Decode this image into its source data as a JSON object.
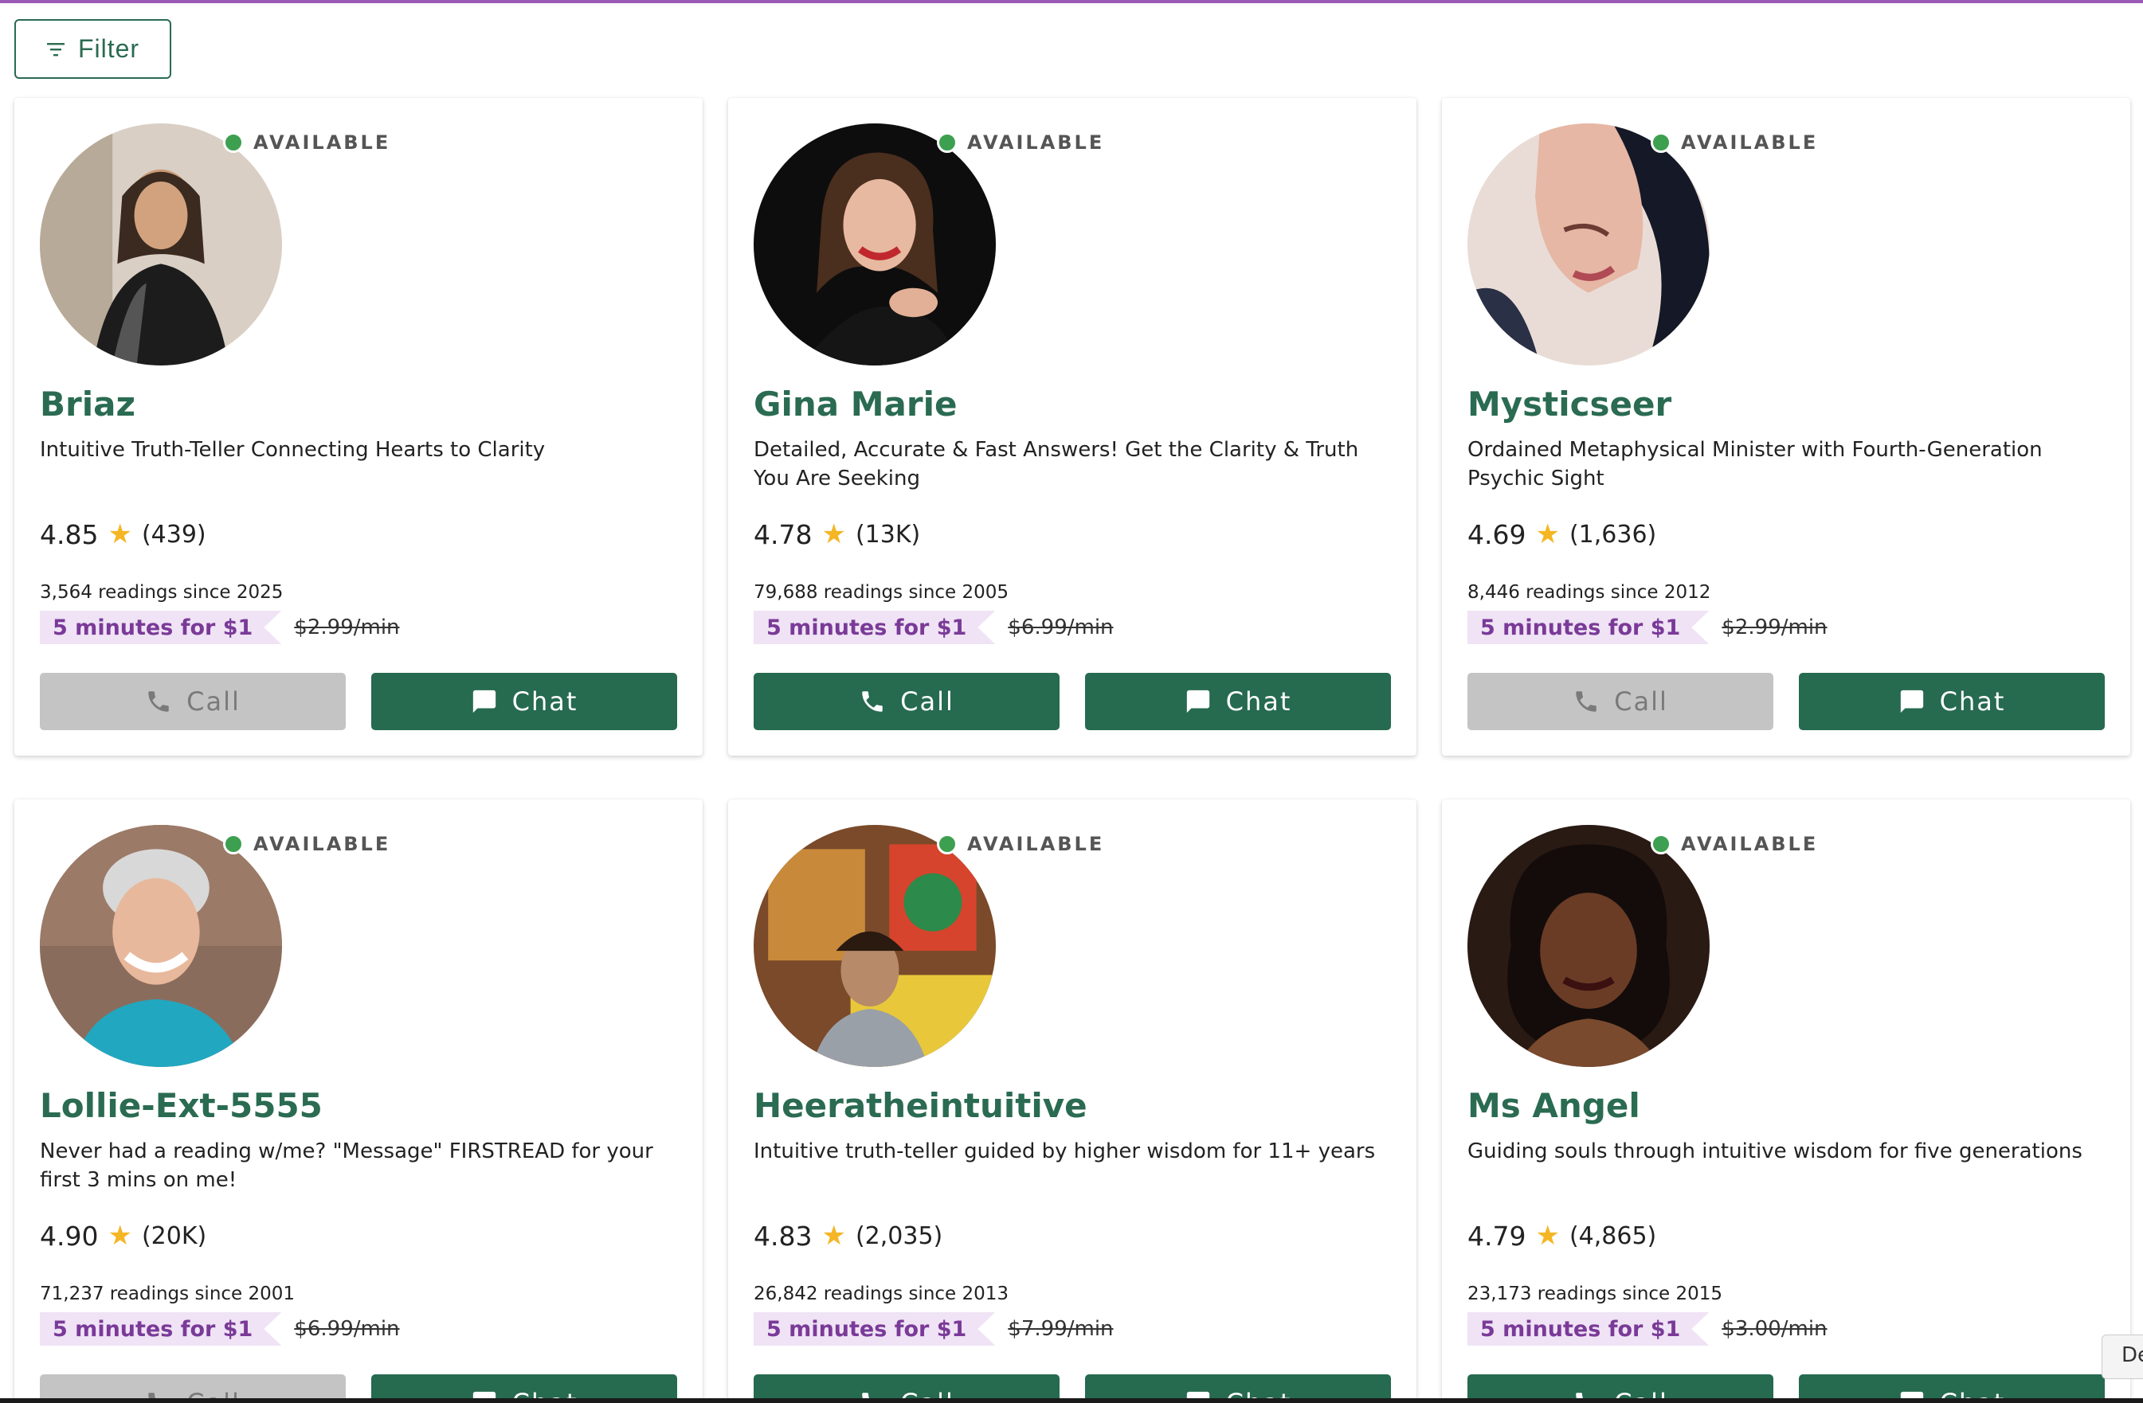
{
  "toolbar": {
    "filter_label": "Filter"
  },
  "colors": {
    "accent": "#266a50",
    "promo_bg": "#efe3f5",
    "promo_text": "#7a3a98",
    "available": "#3da050",
    "star": "#f5b625"
  },
  "advisors": [
    {
      "status": "AVAILABLE",
      "name": "Briaz",
      "tagline": "Intuitive Truth-Teller Connecting Hearts to Clarity",
      "rating": "4.85",
      "reviews": "(439)",
      "readings": "3,564 readings since 2025",
      "promo": "5 minutes for $1",
      "price": "$2.99/min",
      "call_label": "Call",
      "chat_label": "Chat",
      "call_enabled": false
    },
    {
      "status": "AVAILABLE",
      "name": "Gina Marie",
      "tagline": "Detailed, Accurate & Fast Answers! Get the Clarity & Truth You Are Seeking",
      "rating": "4.78",
      "reviews": "(13K)",
      "readings": "79,688 readings since 2005",
      "promo": "5 minutes for $1",
      "price": "$6.99/min",
      "call_label": "Call",
      "chat_label": "Chat",
      "call_enabled": true
    },
    {
      "status": "AVAILABLE",
      "name": "Mysticseer",
      "tagline": "Ordained Metaphysical Minister with Fourth-Generation Psychic Sight",
      "rating": "4.69",
      "reviews": "(1,636)",
      "readings": "8,446 readings since 2012",
      "promo": "5 minutes for $1",
      "price": "$2.99/min",
      "call_label": "Call",
      "chat_label": "Chat",
      "call_enabled": false
    },
    {
      "status": "AVAILABLE",
      "name": "Lollie-Ext-5555",
      "tagline": "Never had a reading w/me? \"Message\" FIRSTREAD for your first 3 mins on me!",
      "rating": "4.90",
      "reviews": "(20K)",
      "readings": "71,237 readings since 2001",
      "promo": "5 minutes for $1",
      "price": "$6.99/min",
      "call_label": "Call",
      "chat_label": "Chat",
      "call_enabled": false
    },
    {
      "status": "AVAILABLE",
      "name": "Heeratheintuitive",
      "tagline": "Intuitive truth-teller guided by higher wisdom for 11+ years",
      "rating": "4.83",
      "reviews": "(2,035)",
      "readings": "26,842 readings since 2013",
      "promo": "5 minutes for $1",
      "price": "$7.99/min",
      "call_label": "Call",
      "chat_label": "Chat",
      "call_enabled": true
    },
    {
      "status": "AVAILABLE",
      "name": "Ms Angel",
      "tagline": "Guiding souls through intuitive wisdom for five generations",
      "rating": "4.79",
      "reviews": "(4,865)",
      "readings": "23,173 readings since 2015",
      "promo": "5 minutes for $1",
      "price": "$3.00/min",
      "call_label": "Call",
      "chat_label": "Chat",
      "call_enabled": true
    }
  ],
  "side_tab": {
    "label": "De"
  }
}
